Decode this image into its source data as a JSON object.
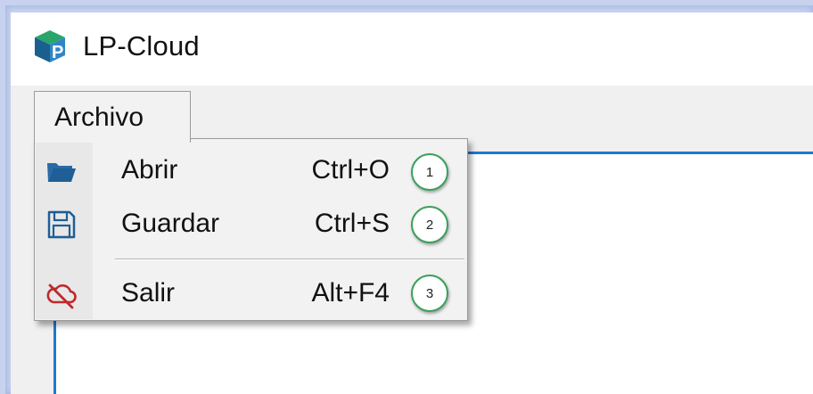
{
  "window": {
    "title": "LP-Cloud",
    "app_icon": "lp-cloud-logo-icon"
  },
  "menubar": {
    "menus": [
      {
        "label": "Archivo"
      }
    ]
  },
  "dropdown": {
    "items": [
      {
        "label": "Abrir",
        "shortcut": "Ctrl+O",
        "icon": "folder-open-icon",
        "callout": "1"
      },
      {
        "label": "Guardar",
        "shortcut": "Ctrl+S",
        "icon": "floppy-disk-icon",
        "callout": "2"
      },
      {
        "label": "Salir",
        "shortcut": "Alt+F4",
        "icon": "cloud-off-icon",
        "callout": "3"
      }
    ]
  },
  "colors": {
    "accent": "#1e78d2",
    "callout_border": "#3aa05a",
    "exit_icon": "#c0282d",
    "folder_icon": "#1f5e96"
  }
}
